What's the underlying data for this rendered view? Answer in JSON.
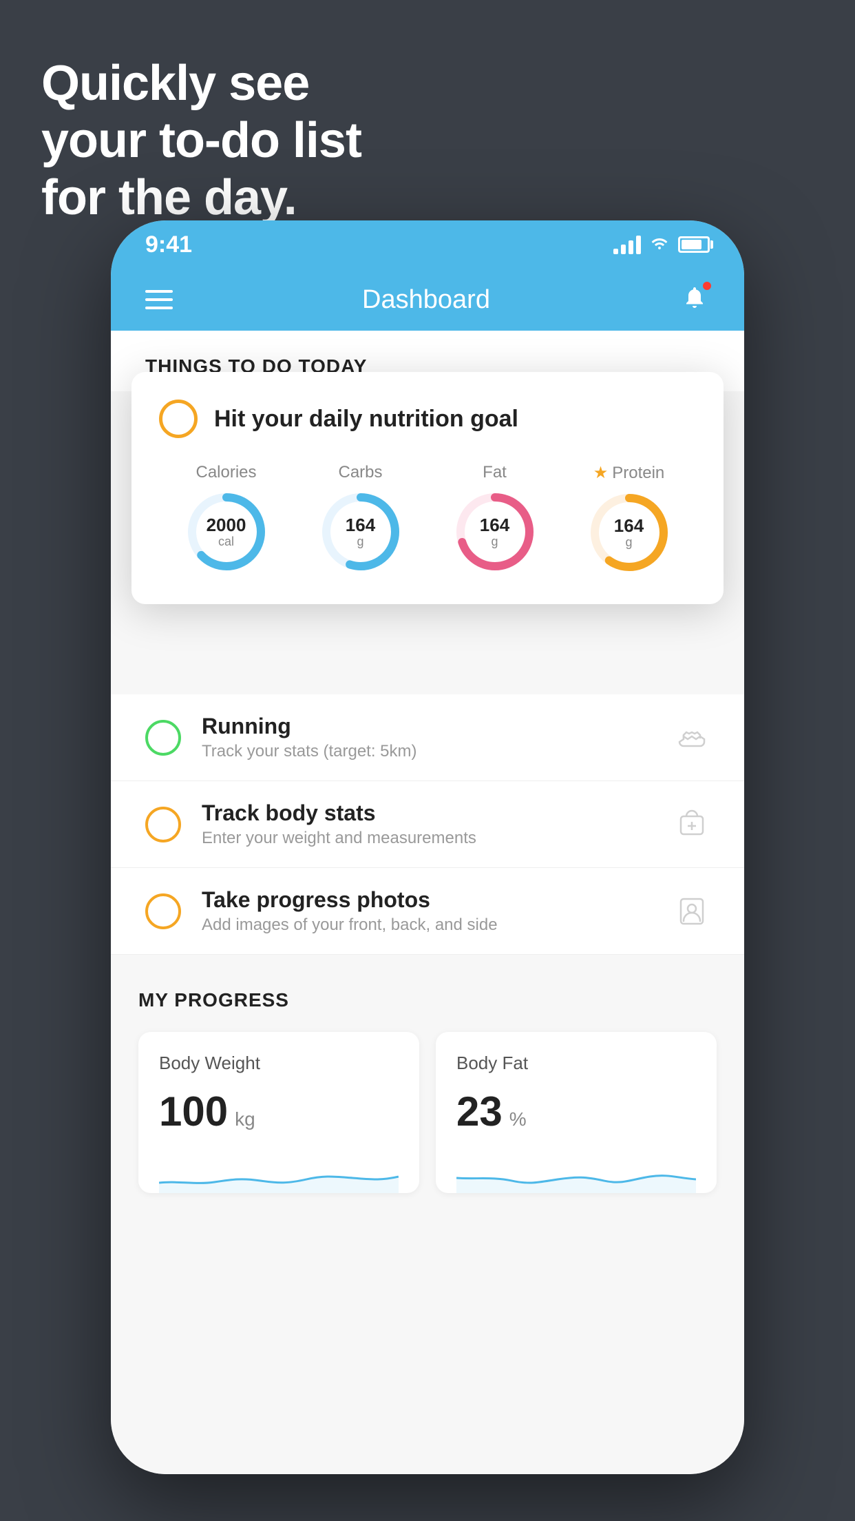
{
  "hero": {
    "line1": "Quickly see",
    "line2": "your to-do list",
    "line3": "for the day."
  },
  "statusBar": {
    "time": "9:41"
  },
  "navBar": {
    "title": "Dashboard"
  },
  "thingsSection": {
    "heading": "THINGS TO DO TODAY"
  },
  "nutritionCard": {
    "circleColor": "#f5a623",
    "title": "Hit your daily nutrition goal",
    "items": [
      {
        "label": "Calories",
        "value": "2000",
        "unit": "cal",
        "color": "#4db8e8",
        "pct": 65,
        "star": false
      },
      {
        "label": "Carbs",
        "value": "164",
        "unit": "g",
        "color": "#4db8e8",
        "pct": 55,
        "star": false
      },
      {
        "label": "Fat",
        "value": "164",
        "unit": "g",
        "color": "#e85d87",
        "pct": 70,
        "star": false
      },
      {
        "label": "Protein",
        "value": "164",
        "unit": "g",
        "color": "#f5a623",
        "pct": 60,
        "star": true
      }
    ]
  },
  "todoItems": [
    {
      "circleColor": "green",
      "title": "Running",
      "subtitle": "Track your stats (target: 5km)",
      "iconType": "shoe"
    },
    {
      "circleColor": "yellow",
      "title": "Track body stats",
      "subtitle": "Enter your weight and measurements",
      "iconType": "scale"
    },
    {
      "circleColor": "yellow",
      "title": "Take progress photos",
      "subtitle": "Add images of your front, back, and side",
      "iconType": "person"
    }
  ],
  "progressSection": {
    "heading": "MY PROGRESS",
    "cards": [
      {
        "title": "Body Weight",
        "value": "100",
        "unit": "kg"
      },
      {
        "title": "Body Fat",
        "value": "23",
        "unit": "%"
      }
    ]
  }
}
